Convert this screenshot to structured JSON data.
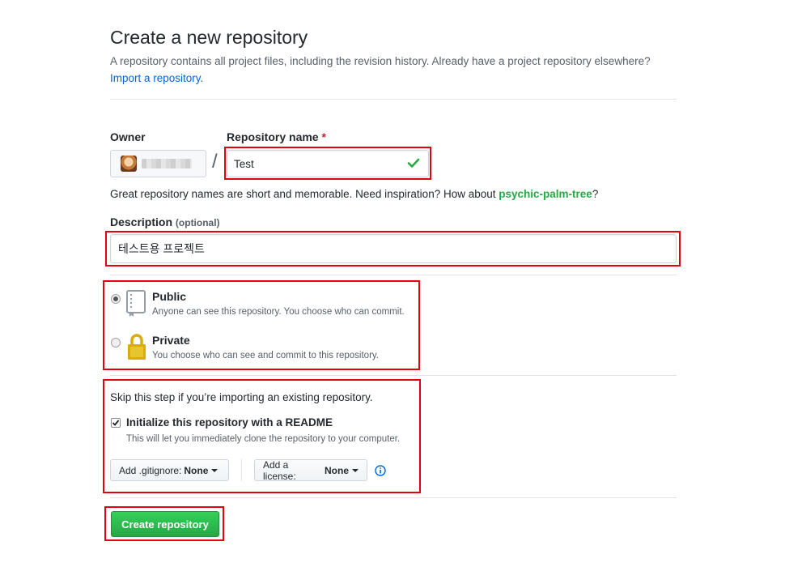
{
  "header": {
    "title": "Create a new repository",
    "subtitle": "A repository contains all project files, including the revision history. Already have a project repository elsewhere?",
    "import_link": "Import a repository."
  },
  "owner": {
    "label": "Owner"
  },
  "repo_name": {
    "label": "Repository name",
    "required_marker": "*",
    "value": "Test",
    "hint_prefix": "Great repository names are short and memorable. Need inspiration? How about",
    "suggestion": "psychic-palm-tree",
    "hint_suffix": "?"
  },
  "description": {
    "label": "Description",
    "optional": "(optional)",
    "value": "테스트용 프로젝트"
  },
  "visibility": {
    "public": {
      "title": "Public",
      "desc": "Anyone can see this repository. You choose who can commit.",
      "selected": true
    },
    "private": {
      "title": "Private",
      "desc": "You choose who can see and commit to this repository.",
      "selected": false
    }
  },
  "init": {
    "skip_text": "Skip this step if you’re importing an existing repository.",
    "readme_label": "Initialize this repository with a README",
    "readme_desc": "This will let you immediately clone the repository to your computer.",
    "readme_checked": true,
    "gitignore_label": "Add .gitignore:",
    "gitignore_value": "None",
    "license_label": "Add a license:",
    "license_value": "None"
  },
  "create_button": "Create repository",
  "colors": {
    "accent_green": "#28a745",
    "link_blue": "#0366d6",
    "highlight_red": "#e3000f"
  }
}
